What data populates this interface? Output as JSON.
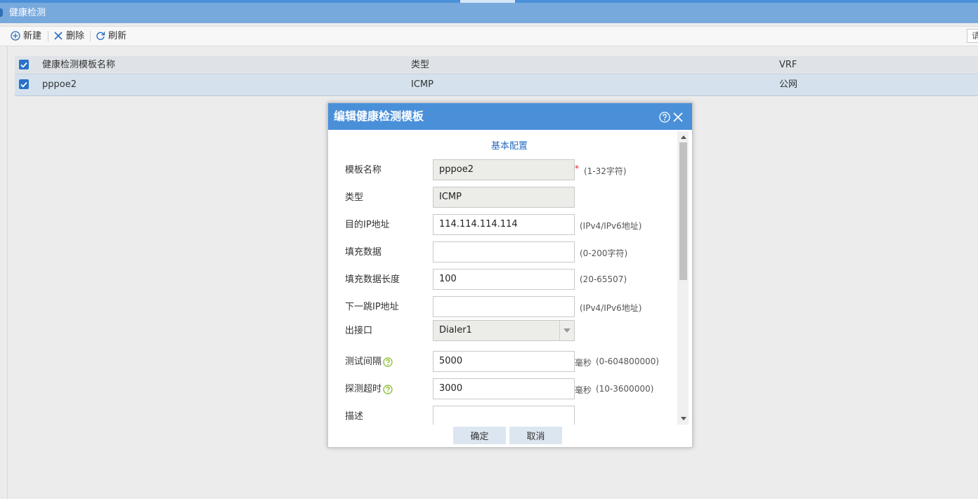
{
  "page": {
    "title": "健康检测"
  },
  "toolbar": {
    "new_label": "新建",
    "delete_label": "删除",
    "refresh_label": "刷新",
    "right_partial": "请"
  },
  "grid": {
    "columns": [
      "健康检测模板名称",
      "类型",
      "VRF"
    ],
    "rows": [
      {
        "name": "pppoe2",
        "type": "ICMP",
        "vrf": "公网",
        "checked": true
      }
    ]
  },
  "dialog": {
    "title": "编辑健康检测模板",
    "section": "基本配置",
    "fields": {
      "template_name": {
        "label": "模板名称",
        "value": "pppoe2",
        "required_mark": "*",
        "hint": "(1-32字符)"
      },
      "type": {
        "label": "类型",
        "value": "ICMP"
      },
      "dest_ip": {
        "label": "目的IP地址",
        "value": "114.114.114.114",
        "hint": "(IPv4/IPv6地址)"
      },
      "fill_data": {
        "label": "填充数据",
        "value": "",
        "hint": "(0-200字符)"
      },
      "fill_length": {
        "label": "填充数据长度",
        "value": "100",
        "hint": "(20-65507)"
      },
      "next_hop": {
        "label": "下一跳IP地址",
        "value": "",
        "hint": "(IPv4/IPv6地址)"
      },
      "out_interface": {
        "label": "出接口",
        "value": "Dialer1"
      },
      "test_interval": {
        "label": "测试间隔",
        "value": "5000",
        "unit": "毫秒",
        "hint": "(0-604800000)"
      },
      "probe_timeout": {
        "label": "探测超时",
        "value": "3000",
        "unit": "毫秒",
        "hint": "(10-3600000)"
      },
      "description": {
        "label": "描述",
        "value": ""
      }
    },
    "ok_label": "确定",
    "cancel_label": "取消"
  },
  "colors": {
    "accent": "#4a90d9",
    "title_bar": "#78a9dc",
    "help_icon": "#7cb518"
  }
}
